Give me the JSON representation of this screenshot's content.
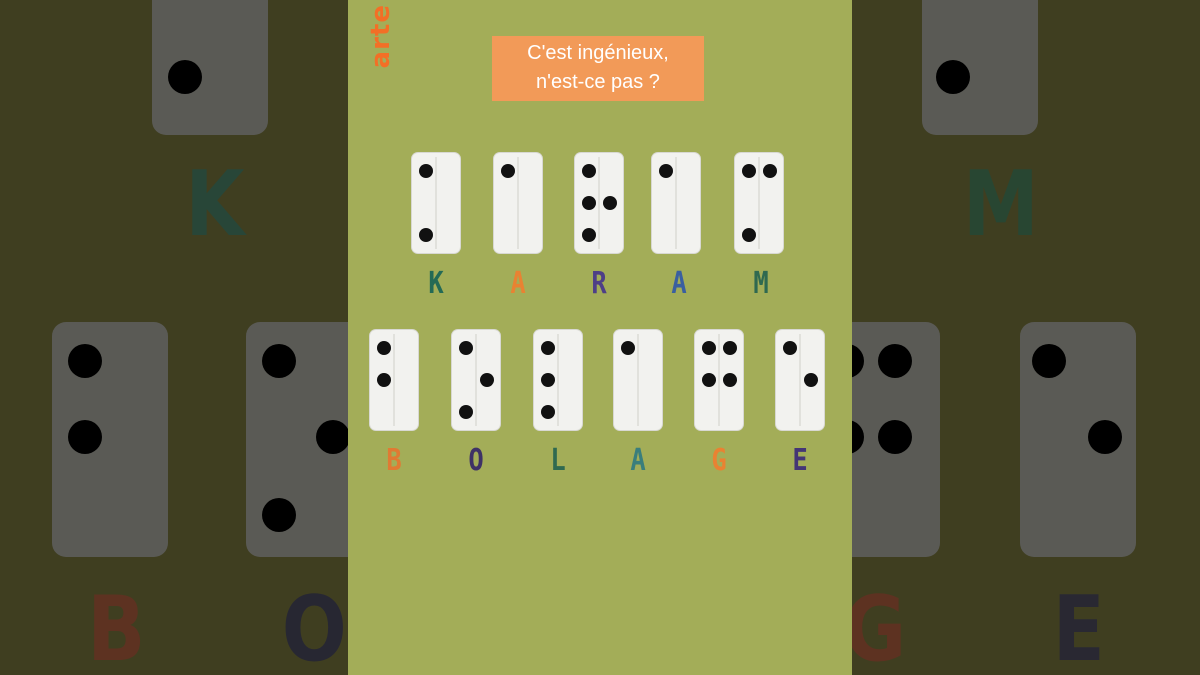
{
  "logo": "arte",
  "caption": {
    "line1": "C'est ingénieux,",
    "line2": "n'est-ce pas ?"
  },
  "colors": {
    "teal": "#246a55",
    "orange": "#e98232",
    "purple": "#4e3f87",
    "blue": "#3a7e7c",
    "green": "#2f6950"
  },
  "word1": [
    {
      "letter": "K",
      "color": "#246a55"
    },
    {
      "letter": "A",
      "color": "#e98232"
    },
    {
      "letter": "R",
      "color": "#4e3f87"
    },
    {
      "letter": "A",
      "color": "#3a5fa0"
    },
    {
      "letter": "M",
      "color": "#2f6950"
    }
  ],
  "word2": [
    {
      "letter": "B",
      "color": "#e07a33"
    },
    {
      "letter": "O",
      "color": "#3e3266"
    },
    {
      "letter": "L",
      "color": "#2f6950"
    },
    {
      "letter": "A",
      "color": "#3a7e7c"
    },
    {
      "letter": "G",
      "color": "#e98232"
    },
    {
      "letter": "E",
      "color": "#443575"
    }
  ],
  "background_letters": {
    "left_top": "K",
    "right_top": "M",
    "left_bottom_1": "B",
    "left_bottom_2": "O",
    "right_bottom_1": "G",
    "right_bottom_2": "E"
  }
}
